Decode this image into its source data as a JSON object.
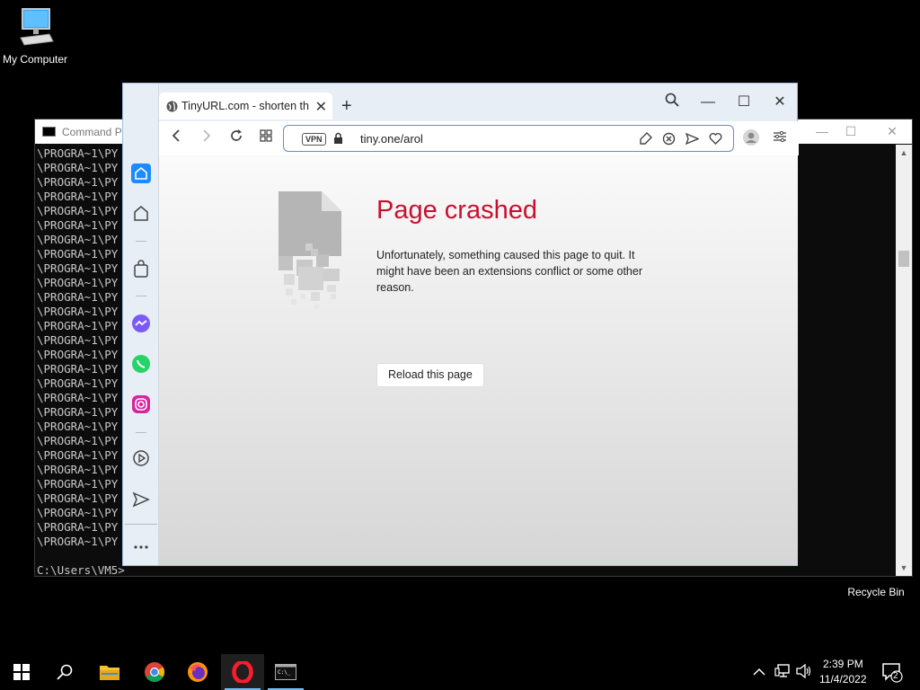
{
  "desktop": {
    "my_computer_label": "My Computer",
    "recycle_bin_label": "Recycle Bin"
  },
  "cmd": {
    "title": "Command P",
    "lines": [
      "\\PROGRA~1\\PY",
      "\\PROGRA~1\\PY",
      "\\PROGRA~1\\PY",
      "\\PROGRA~1\\PY",
      "\\PROGRA~1\\PY",
      "\\PROGRA~1\\PY",
      "\\PROGRA~1\\PY",
      "\\PROGRA~1\\PY",
      "\\PROGRA~1\\PY",
      "\\PROGRA~1\\PY",
      "\\PROGRA~1\\PY",
      "\\PROGRA~1\\PY",
      "\\PROGRA~1\\PY",
      "\\PROGRA~1\\PY",
      "\\PROGRA~1\\PY",
      "\\PROGRA~1\\PY",
      "\\PROGRA~1\\PY",
      "\\PROGRA~1\\PY",
      "\\PROGRA~1\\PY",
      "\\PROGRA~1\\PY",
      "\\PROGRA~1\\PY",
      "\\PROGRA~1\\PY",
      "\\PROGRA~1\\PY",
      "\\PROGRA~1\\PY",
      "\\PROGRA~1\\PY",
      "\\PROGRA~1\\PY",
      "\\PROGRA~1\\PY",
      "\\PROGRA~1\\PY"
    ],
    "prompt": "C:\\Users\\VM5>"
  },
  "browser": {
    "tab_title": "TinyURL.com - shorten that long URL",
    "vpn_label": "VPN",
    "url": "tiny.one/arol",
    "sidebar_icons": [
      "home-icon",
      "bookmarks-icon",
      "shopping-icon",
      "messenger-icon",
      "whatsapp-icon",
      "instagram-icon",
      "player-icon",
      "send-icon",
      "more-icon"
    ],
    "accent_color": "#c8102e"
  },
  "crash_page": {
    "title": "Page crashed",
    "message": "Unfortunately, something caused this page to quit. It might have been an extensions conflict or some other reason.",
    "reload_label": "Reload this page"
  },
  "taskbar": {
    "apps": [
      "start-icon",
      "search-icon",
      "file-explorer-icon",
      "chrome-icon",
      "firefox-icon",
      "opera-icon",
      "cmd-icon"
    ],
    "time": "2:39 PM",
    "date": "11/4/2022",
    "notification_count": "2"
  }
}
